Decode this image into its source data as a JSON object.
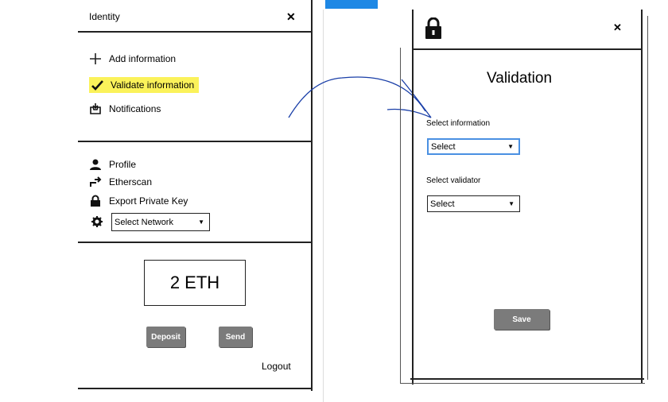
{
  "left_panel": {
    "title": "Identity",
    "close_icon": "✕",
    "menu": [
      {
        "label": "Add information",
        "icon": "plus-icon"
      },
      {
        "label": "Validate information",
        "icon": "check-icon",
        "highlighted": true
      },
      {
        "label": "Notifications",
        "icon": "inbox-icon"
      }
    ],
    "account_menu": [
      {
        "label": "Profile",
        "icon": "user-icon"
      },
      {
        "label": "Etherscan",
        "icon": "share-icon"
      },
      {
        "label": "Export Private Key",
        "icon": "lock-icon"
      }
    ],
    "network_select": {
      "value": "Select Network",
      "icon": "gear-icon"
    },
    "balance": "2 ETH",
    "deposit_label": "Deposit",
    "send_label": "Send",
    "logout_label": "Logout"
  },
  "right_panel": {
    "close_icon": "✕",
    "title": "Validation",
    "select_information_label": "Select information",
    "select_information_value": "Select",
    "select_validator_label": "Select validator",
    "select_validator_value": "Select",
    "save_label": "Save"
  },
  "colors": {
    "highlight": "#fbf25a",
    "button": "#7b7b7b",
    "accent_tab": "#1e88e5",
    "arrow": "#1a3fa8",
    "focus_border": "#4a90e2"
  }
}
